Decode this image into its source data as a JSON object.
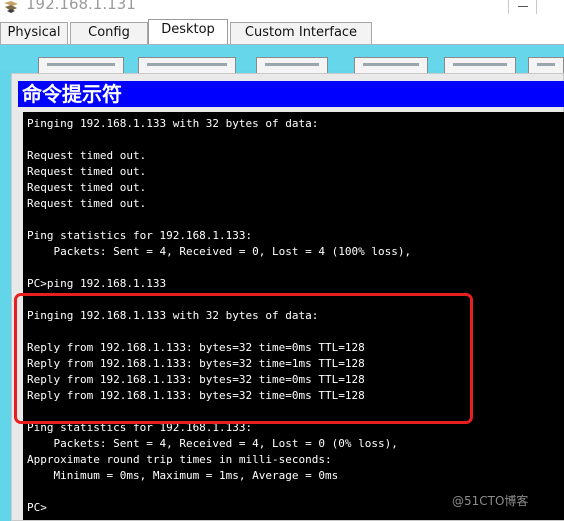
{
  "window": {
    "title": "192.168.1.131"
  },
  "tabs": [
    {
      "label": "Physical"
    },
    {
      "label": "Config"
    },
    {
      "label": "Desktop"
    },
    {
      "label": "Custom Interface"
    }
  ],
  "active_tab": "Desktop",
  "command_prompt": {
    "title": "命令提示符",
    "lines": [
      "Pinging 192.168.1.133 with 32 bytes of data:",
      "",
      "Request timed out.",
      "Request timed out.",
      "Request timed out.",
      "Request timed out.",
      "",
      "Ping statistics for 192.168.1.133:",
      "    Packets: Sent = 4, Received = 0, Lost = 4 (100% loss),",
      "",
      "PC>ping 192.168.1.133",
      "",
      "Pinging 192.168.1.133 with 32 bytes of data:",
      "",
      "Reply from 192.168.1.133: bytes=32 time=0ms TTL=128",
      "Reply from 192.168.1.133: bytes=32 time=1ms TTL=128",
      "Reply from 192.168.1.133: bytes=32 time=0ms TTL=128",
      "Reply from 192.168.1.133: bytes=32 time=0ms TTL=128",
      "",
      "Ping statistics for 192.168.1.133:",
      "    Packets: Sent = 4, Received = 4, Lost = 0 (0% loss),",
      "Approximate round trip times in milli-seconds:",
      "    Minimum = 0ms, Maximum = 1ms, Average = 0ms",
      "",
      "PC>"
    ]
  },
  "watermark": "@51CTO博客",
  "colors": {
    "desktop_bg": "#63d5e8",
    "cmd_title_bg": "#0000ff",
    "terminal_bg": "#000000",
    "highlight": "#e81f1f"
  }
}
